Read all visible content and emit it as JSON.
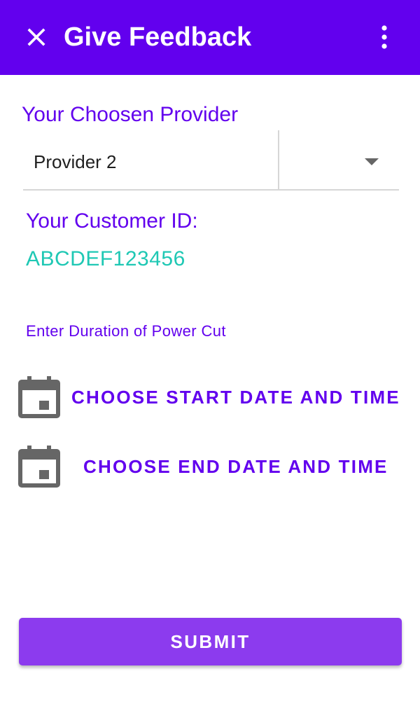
{
  "app_bar": {
    "title": "Give Feedback",
    "close_icon": "close-icon",
    "menu_icon": "more-vert-icon",
    "background": "#6200ee"
  },
  "provider": {
    "heading": "Your Choosen Provider",
    "selected": "Provider 2",
    "dropdown_icon": "arrow-drop-down-icon"
  },
  "customer": {
    "label": "Your Customer ID:",
    "id": "ABCDEF123456",
    "id_color": "#1fc8b4"
  },
  "duration": {
    "label": "Enter Duration of Power Cut",
    "start_button": "CHOOSE START DATE AND TIME",
    "end_button": "CHOOSE END DATE AND TIME",
    "icon": "calendar-icon"
  },
  "submit": {
    "label": "SUBMIT",
    "color": "#8c3bee"
  },
  "colors": {
    "primary": "#6200ee",
    "icon_gray": "#666666"
  }
}
